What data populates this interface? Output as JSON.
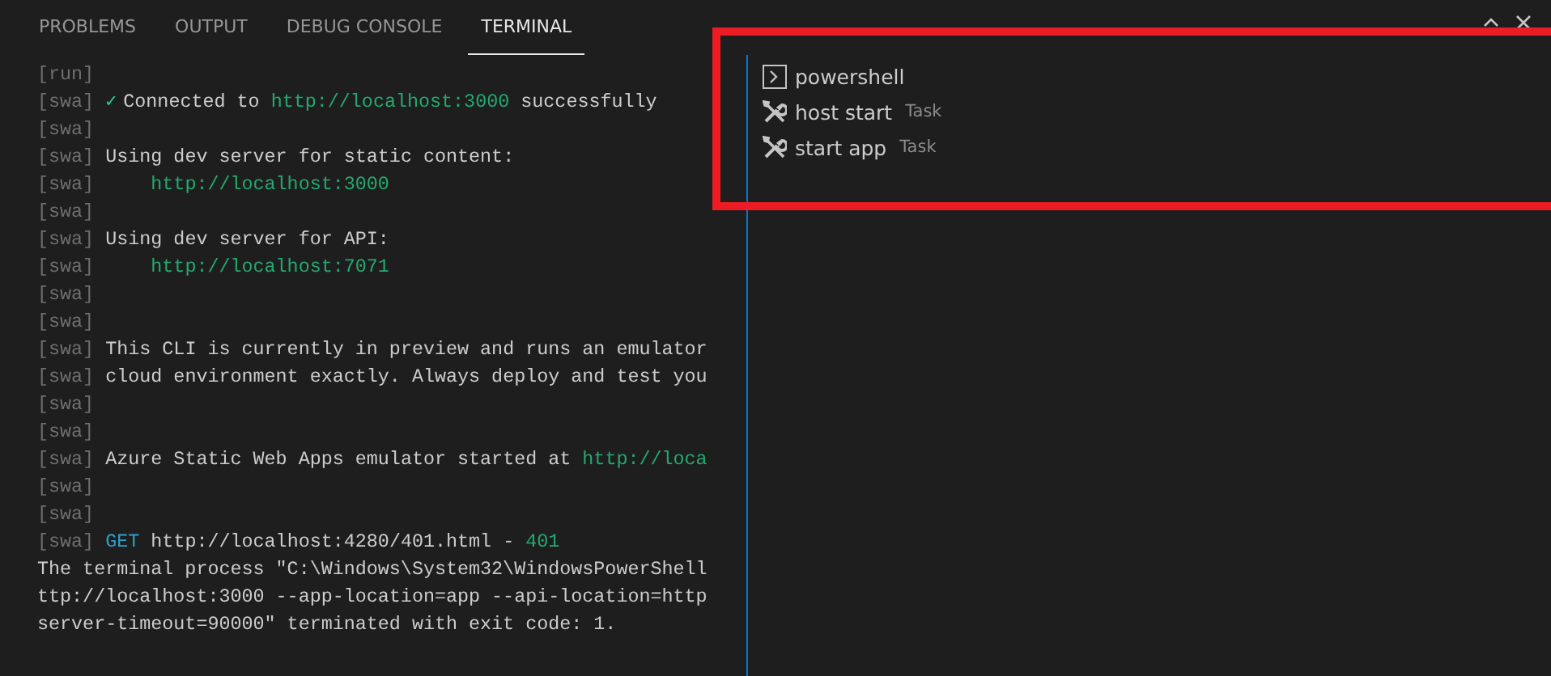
{
  "tabs": [
    {
      "label": "PROBLEMS",
      "selected": false
    },
    {
      "label": "OUTPUT",
      "selected": false
    },
    {
      "label": "DEBUG CONSOLE",
      "selected": false
    },
    {
      "label": "TERMINAL",
      "selected": true
    }
  ],
  "terminal": {
    "lines": [
      {
        "prefix": "[run]"
      },
      {
        "prefix": "[swa]",
        "segments": [
          {
            "kind": "check",
            "text": "✓"
          },
          {
            "kind": "text",
            "text": "Connected to "
          },
          {
            "kind": "url",
            "text": "http://localhost:3000"
          },
          {
            "kind": "text",
            "text": " successfully"
          }
        ]
      },
      {
        "prefix": "[swa]"
      },
      {
        "prefix": "[swa]",
        "segments": [
          {
            "kind": "text",
            "text": "Using dev server for static content:"
          }
        ]
      },
      {
        "prefix": "[swa]",
        "segments": [
          {
            "kind": "url",
            "text": "    http://localhost:3000"
          }
        ]
      },
      {
        "prefix": "[swa]"
      },
      {
        "prefix": "[swa]",
        "segments": [
          {
            "kind": "text",
            "text": "Using dev server for API:"
          }
        ]
      },
      {
        "prefix": "[swa]",
        "segments": [
          {
            "kind": "url",
            "text": "    http://localhost:7071"
          }
        ]
      },
      {
        "prefix": "[swa]"
      },
      {
        "prefix": "[swa]"
      },
      {
        "prefix": "[swa]",
        "segments": [
          {
            "kind": "text",
            "text": "This CLI is currently in preview and runs an emulator"
          }
        ]
      },
      {
        "prefix": "[swa]",
        "segments": [
          {
            "kind": "text",
            "text": "cloud environment exactly. Always deploy and test you"
          }
        ]
      },
      {
        "prefix": "[swa]"
      },
      {
        "prefix": "[swa]"
      },
      {
        "prefix": "[swa]",
        "segments": [
          {
            "kind": "text",
            "text": "Azure Static Web Apps emulator started at "
          },
          {
            "kind": "url",
            "text": "http://loca"
          }
        ]
      },
      {
        "prefix": "[swa]"
      },
      {
        "prefix": "[swa]"
      },
      {
        "prefix": "[swa]",
        "segments": [
          {
            "kind": "verb",
            "text": "GET"
          },
          {
            "kind": "text",
            "text": " http://localhost:4280/401.html - "
          },
          {
            "kind": "url",
            "text": "401"
          }
        ]
      },
      {
        "segments": [
          {
            "kind": "text",
            "text": "The terminal process \"C:\\Windows\\System32\\WindowsPowerShell"
          }
        ]
      },
      {
        "segments": [
          {
            "kind": "text",
            "text": "ttp://localhost:3000 --app-location=app --api-location=http"
          }
        ]
      },
      {
        "segments": [
          {
            "kind": "text",
            "text": "server-timeout=90000\" terminated with exit code: 1."
          }
        ]
      }
    ]
  },
  "terminal_list": [
    {
      "kind": "shell",
      "label": "powershell"
    },
    {
      "kind": "task",
      "label": "host start",
      "detail": "Task"
    },
    {
      "kind": "task",
      "label": "start app",
      "detail": "Task"
    }
  ],
  "annotation": {
    "kind": "rectangle"
  }
}
